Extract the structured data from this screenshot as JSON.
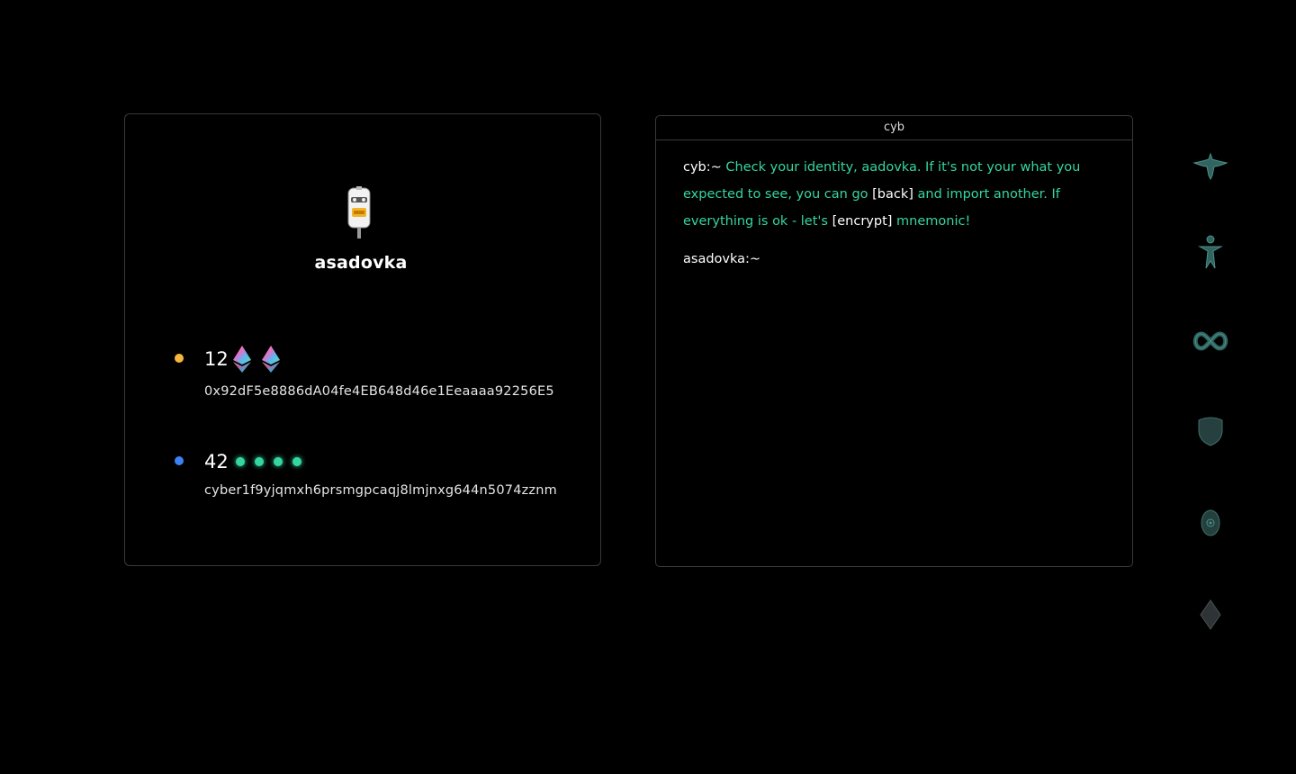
{
  "identity": {
    "username": "asadovka",
    "accounts": [
      {
        "balance": "12",
        "token_icons": [
          "ethereum-icon",
          "ethereum-icon"
        ],
        "dot_color": "#f6b73c",
        "address": "0x92dF5e8886dA04fe4EB648d46e1Eeaaaa92256E5"
      },
      {
        "balance": "42",
        "token_icons": [
          "cyb-token-icon",
          "cyb-token-icon",
          "cyb-token-icon",
          "cyb-token-icon"
        ],
        "dot_color": "#3b82f6",
        "address": "cyber1f9yjqmxh6prsmgpcaqj8lmjnxg644n5074zznm"
      }
    ]
  },
  "terminal": {
    "title": "cyb",
    "prompt": "cyb:~",
    "msg_part1": "Check your identity, aadovka. If it's not your what you expected to see, you can go",
    "cmd_back": "[back]",
    "msg_part2": "and import another. If everything is ok -  let's",
    "cmd_encrypt": "[encrypt]",
    "msg_part3": "mnemonic!",
    "user_prompt": "asadovka:~"
  },
  "nav": {
    "items": [
      "bird-icon",
      "person-icon",
      "infinity-icon",
      "shield-icon",
      "eye-icon",
      "diamond-icon"
    ]
  },
  "colors": {
    "accent": "#36d6a0",
    "nav_icon": "#2e5e5a",
    "border": "#3a3a3a"
  }
}
